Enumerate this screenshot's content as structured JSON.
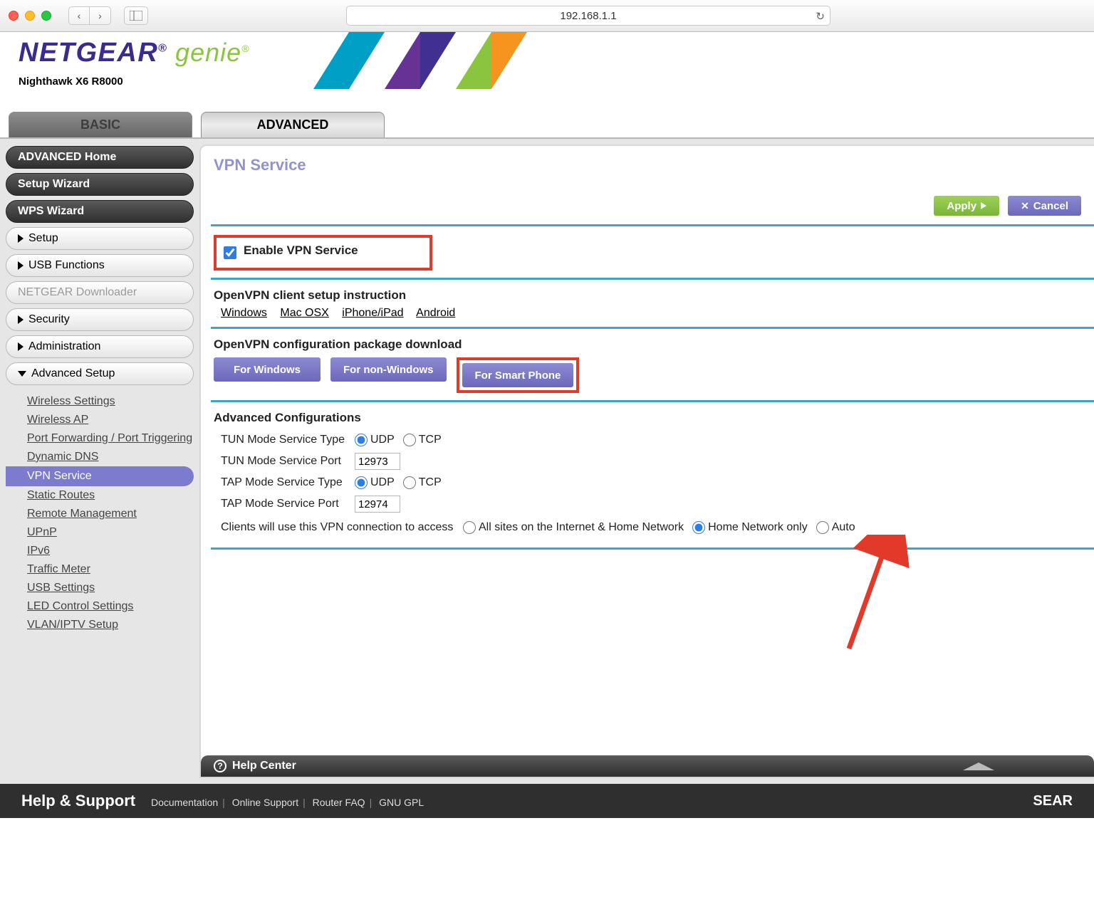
{
  "chrome": {
    "url": "192.168.1.1"
  },
  "brand": {
    "name": "NETGEAR",
    "product": "genie",
    "model": "Nighthawk X6 R8000"
  },
  "tabs": {
    "basic": "BASIC",
    "advanced": "ADVANCED"
  },
  "sidebar": {
    "pills": [
      "ADVANCED Home",
      "Setup Wizard",
      "WPS Wizard"
    ],
    "acc": {
      "setup": "Setup",
      "usb": "USB Functions",
      "downloader": "NETGEAR Downloader",
      "security": "Security",
      "admin": "Administration",
      "advsetup": "Advanced Setup"
    },
    "sub": {
      "wireless_settings": "Wireless Settings",
      "wireless_ap": "Wireless AP",
      "port_fwd": "Port Forwarding / Port Triggering",
      "ddns": "Dynamic DNS",
      "vpn": "VPN Service",
      "static": "Static Routes",
      "remote": "Remote Management",
      "upnp": "UPnP",
      "ipv6": "IPv6",
      "traffic": "Traffic Meter",
      "usbset": "USB Settings",
      "led": "LED Control Settings",
      "vlan": "VLAN/IPTV Setup"
    }
  },
  "page": {
    "title": "VPN Service",
    "apply": "Apply",
    "cancel": "Cancel",
    "enable_label": "Enable VPN Service",
    "client_header": "OpenVPN client setup instruction",
    "client_links": {
      "win": "Windows",
      "mac": "Mac OSX",
      "ios": "iPhone/iPad",
      "android": "Android"
    },
    "pkg_header": "OpenVPN configuration package download",
    "pkg": {
      "win": "For Windows",
      "nonwin": "For non-Windows",
      "phone": "For Smart Phone"
    },
    "adv_header": "Advanced Configurations",
    "tun_type_label": "TUN Mode Service Type",
    "tun_port_label": "TUN Mode Service Port",
    "tap_type_label": "TAP Mode Service Type",
    "tap_port_label": "TAP Mode Service Port",
    "access_label": "Clients will use this VPN connection to access",
    "opt_udp": "UDP",
    "opt_tcp": "TCP",
    "tun_port": "12973",
    "tap_port": "12974",
    "access_all": "All sites on the Internet & Home Network",
    "access_home": "Home Network only",
    "access_auto": "Auto",
    "help_center": "Help Center"
  },
  "footer": {
    "title": "Help & Support",
    "doc": "Documentation",
    "online": "Online Support",
    "faq": "Router FAQ",
    "gpl": "GNU GPL",
    "search": "SEAR"
  }
}
